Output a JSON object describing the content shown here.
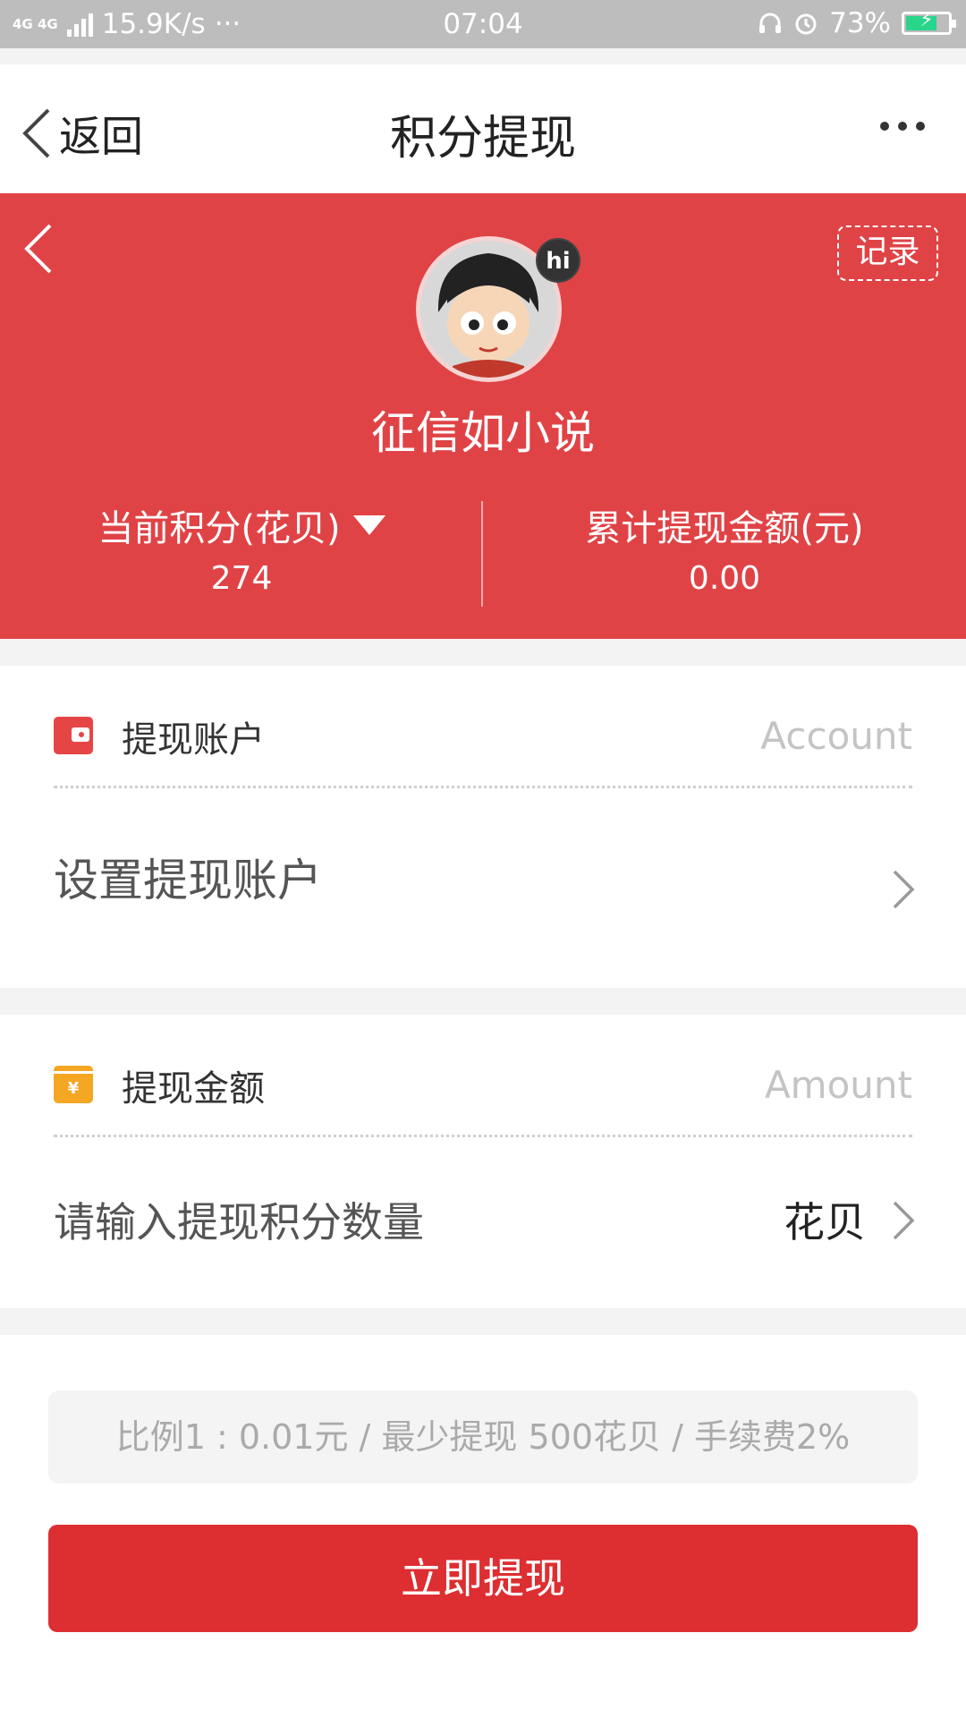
{
  "status": {
    "net_type": "4G 4G",
    "speed": "15.9K/s",
    "dots": "···",
    "time": "07:04",
    "battery": "73%",
    "battery_level": 0.73
  },
  "nav": {
    "back_label": "返回",
    "title": "积分提现"
  },
  "profile": {
    "record_label": "记录",
    "badge": "hi",
    "username": "征信如小说",
    "points_label": "当前积分(花贝)",
    "points_value": "274",
    "total_label": "累计提现金额(元)",
    "total_value": "0.00"
  },
  "account": {
    "title": "提现账户",
    "hint": "Account",
    "row_label": "设置提现账户"
  },
  "amount": {
    "title": "提现金额",
    "hint": "Amount",
    "placeholder": "请输入提现积分数量",
    "unit": "花贝"
  },
  "ratio_text": "比例1 : 0.01元 / 最少提现 500花贝 / 手续费2%",
  "submit_label": "立即提现",
  "colors": {
    "brand_red": "#e04346",
    "button_red": "#dd2e32",
    "wallet_icon": "#e64545",
    "money_icon": "#f5a623"
  }
}
